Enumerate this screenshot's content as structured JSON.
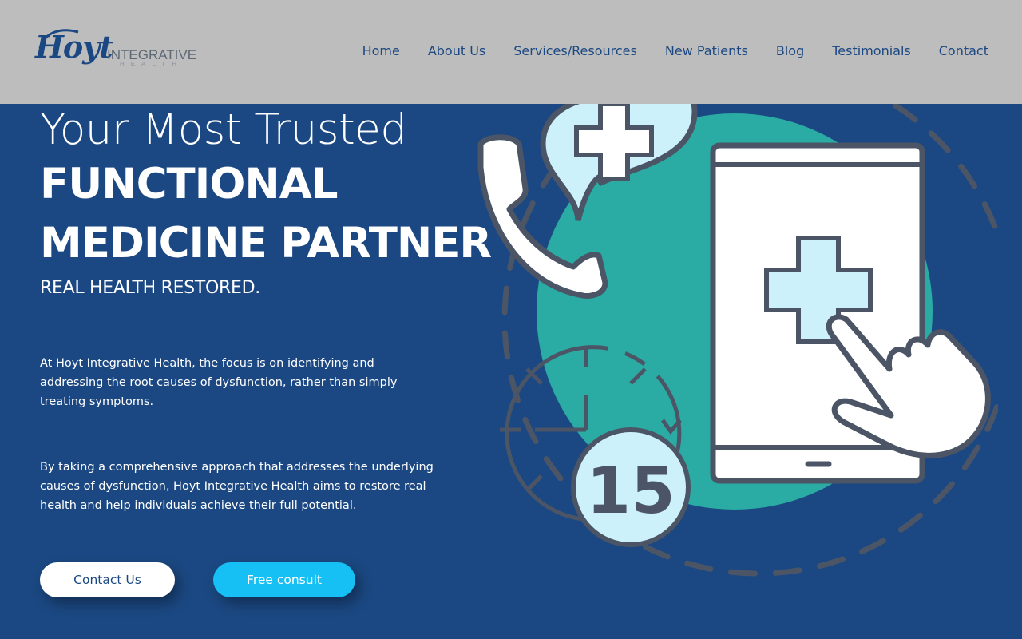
{
  "header": {
    "logo": {
      "script": "Hoyt",
      "word": "INTEGRATIVE",
      "sub": "HEALTH"
    },
    "nav": [
      "Home",
      "About Us",
      "Services/Resources",
      "New Patients",
      "Blog",
      "Testimonials",
      "Contact"
    ]
  },
  "hero": {
    "line1": "Your Most Trusted",
    "line2": "FUNCTIONAL",
    "line3": "MEDICINE PARTNER",
    "tagline": "REAL HEALTH RESTORED.",
    "paragraph1": "At Hoyt Integrative Health, the focus is on identifying and addressing the root causes of dysfunction, rather than simply treating symptoms.",
    "paragraph2": "By taking a comprehensive approach that addresses the underlying causes of dysfunction, Hoyt Integrative Health aims to restore real health and help individuals achieve their full potential."
  },
  "buttons": {
    "contact": "Contact Us",
    "consult": "Free consult"
  },
  "illustration": {
    "timer_value": "15"
  },
  "colors": {
    "primary": "#1b4882",
    "accent": "#17c0f4",
    "teal": "#2aaba3",
    "header_bg": "#bdbdbd"
  }
}
